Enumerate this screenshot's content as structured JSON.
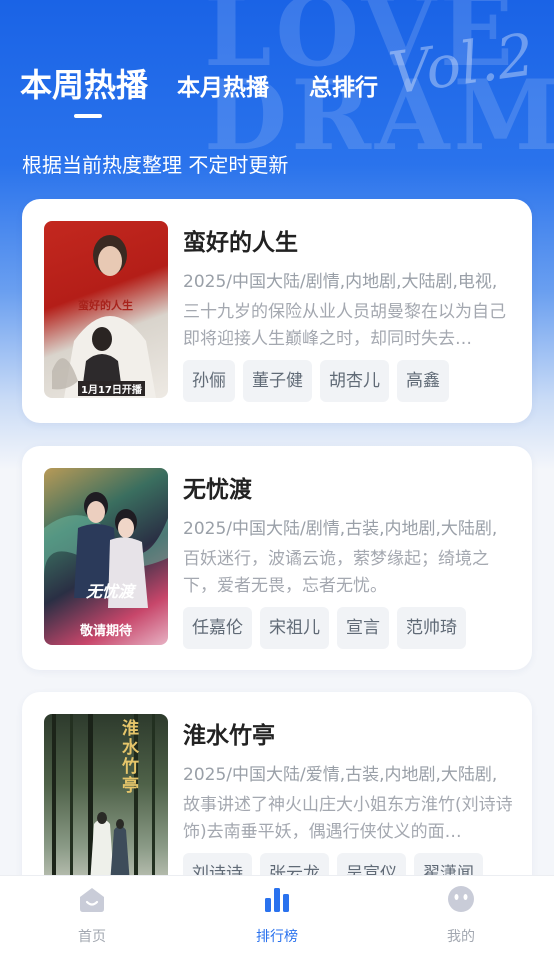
{
  "colors": {
    "accent": "#2a72ee",
    "nav_inactive": "#a3a8b1"
  },
  "header": {
    "tabs": [
      {
        "label": "本周热播",
        "active": true
      },
      {
        "label": "本月热播",
        "active": false
      },
      {
        "label": "总排行",
        "active": false
      }
    ],
    "subtitle": "根据当前热度整理 不定时更新"
  },
  "cards": [
    {
      "title": "蛮好的人生",
      "meta": "2025/中国大陆/剧情,内地剧,大陆剧,电视,",
      "desc": "三十九岁的保险从业人员胡曼黎在以为自己即将迎接人生巅峰之时，却同时失去…",
      "poster_text": "蛮好的人生",
      "poster_caption": "1月17日开播",
      "tags": [
        "孙俪",
        "董子健",
        "胡杏儿",
        "高鑫"
      ]
    },
    {
      "title": "无忧渡",
      "meta": "2025/中国大陆/剧情,古装,内地剧,大陆剧,",
      "desc": "百妖迷行，波谲云诡，萦梦缘起；绮境之下，爱者无畏，忘者无忧。",
      "poster_text": "无忧渡",
      "poster_caption": "敬请期待",
      "tags": [
        "任嘉伦",
        "宋祖儿",
        "宣言",
        "范帅琦"
      ]
    },
    {
      "title": "淮水竹亭",
      "meta": "2025/中国大陆/爱情,古装,内地剧,大陆剧,",
      "desc": "故事讲述了神火山庄大小姐东方淮竹(刘诗诗 饰)去南垂平妖，偶遇行侠仗义的面…",
      "poster_text": "淮水竹亭",
      "poster_caption": "",
      "tags": [
        "刘诗诗",
        "张云龙",
        "吴宣仪",
        "翟潇闻"
      ]
    }
  ],
  "nav": [
    {
      "label": "首页",
      "icon": "home-icon",
      "active": false
    },
    {
      "label": "排行榜",
      "icon": "chart-bar-icon",
      "active": true
    },
    {
      "label": "我的",
      "icon": "face-icon",
      "active": false
    }
  ]
}
